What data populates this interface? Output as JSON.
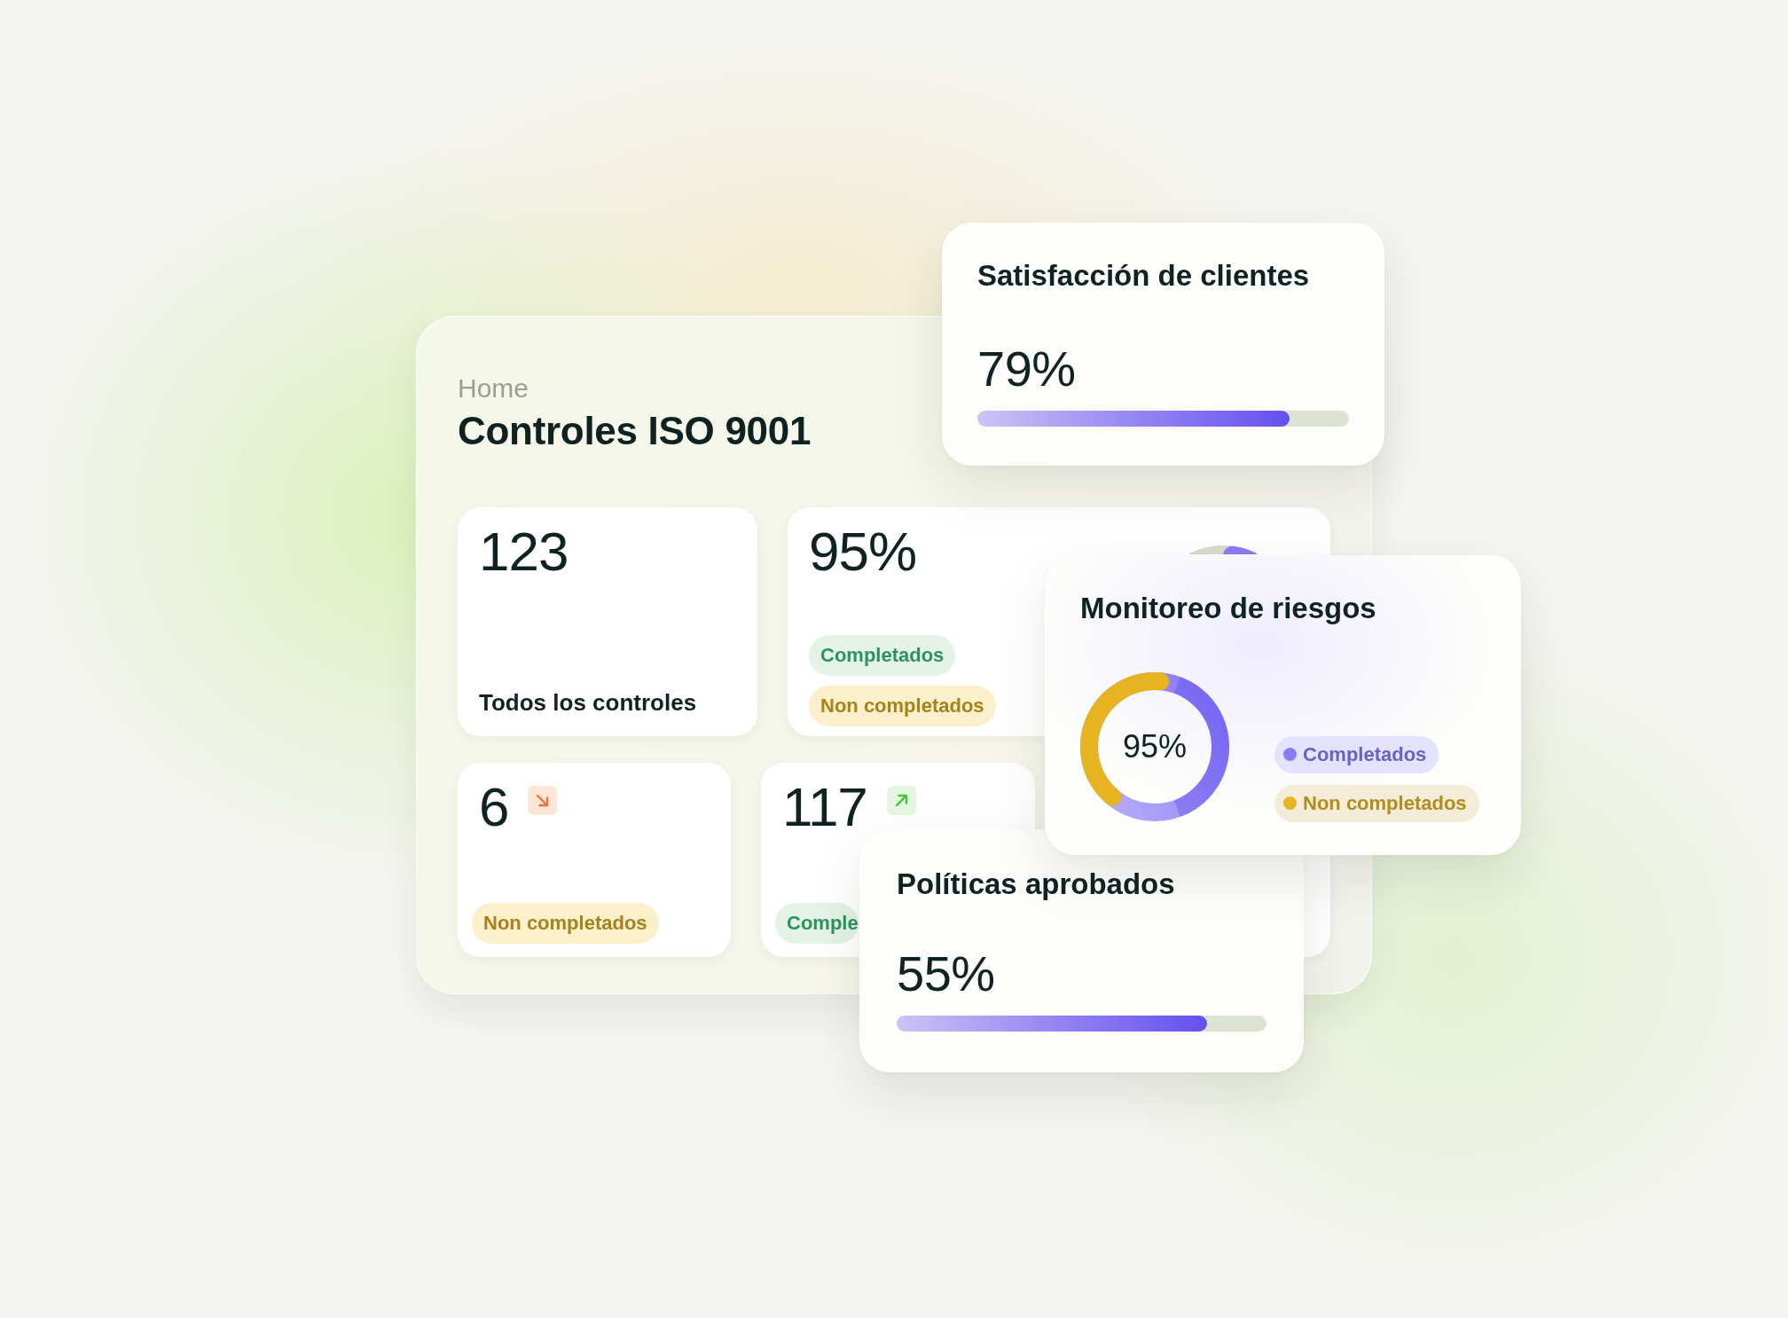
{
  "breadcrumb": "Home",
  "title": "Controles ISO 9001",
  "stats": [
    {
      "kind": "label",
      "value": "123",
      "label": "Todos los controles"
    },
    {
      "kind": "ring",
      "value": "95%",
      "badges": [
        {
          "label": "Completados",
          "kind": "success"
        },
        {
          "label": "Non completados",
          "kind": "warning"
        }
      ]
    },
    {
      "kind": "trend",
      "value": "6",
      "rising": false,
      "badges": [
        {
          "label": "Non completados",
          "kind": "warning"
        }
      ]
    },
    {
      "kind": "trend",
      "value": "117",
      "rising": true,
      "badges": [
        {
          "label": "Comple",
          "kind": "success"
        }
      ]
    }
  ],
  "satisfaction": {
    "title": "Satisfacción de clientes",
    "value": "79%",
    "level": 0.84
  },
  "risk_monitoring": {
    "title": "Monitoreo de riesgos",
    "value": "95%",
    "legend": [
      {
        "label": "Completados",
        "color": "#8b7cf6"
      },
      {
        "label": "Non completados",
        "color": "#e5b420"
      }
    ]
  },
  "policies": {
    "title": "Políticas aprobados",
    "value": "55%",
    "level": 0.84
  }
}
